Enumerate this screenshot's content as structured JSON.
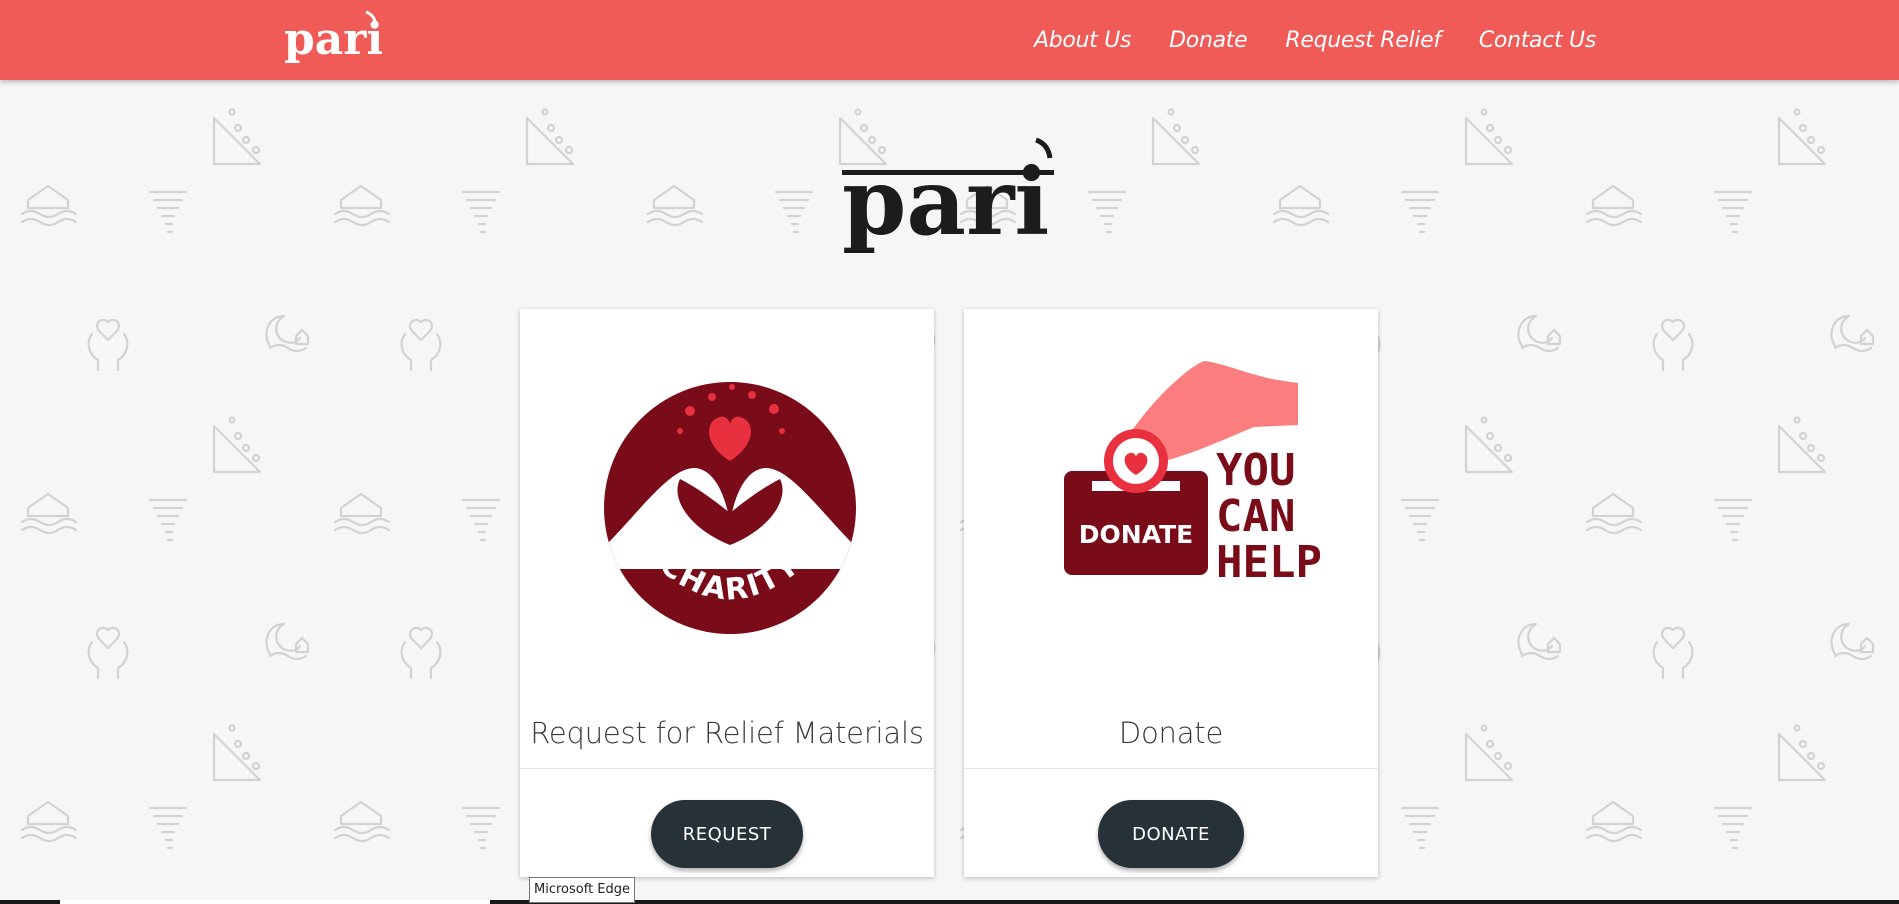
{
  "brand": {
    "logo_text": "pari"
  },
  "nav": {
    "links": [
      {
        "label": "About Us"
      },
      {
        "label": "Donate"
      },
      {
        "label": "Request Relief"
      },
      {
        "label": "Contact Us"
      }
    ]
  },
  "hero": {
    "logo_text": "pari"
  },
  "cards": [
    {
      "image_text": "CHARITY",
      "title": "Request for Relief Materials",
      "button_label": "REQUEST"
    },
    {
      "image_text_donate": "DONATE",
      "image_text_you": "YOU",
      "image_text_can": "CAN",
      "image_text_help": "HELP",
      "title": "Donate",
      "button_label": "DONATE"
    }
  ],
  "tooltip": {
    "text": "Microsoft Edge"
  },
  "colors": {
    "navbar": "#f05a57",
    "button": "#263238",
    "charity_maroon": "#7a0b18",
    "heart_red": "#e8303f",
    "hand_pink": "#fb7d7d",
    "pattern_icon": "#d2d2d2"
  }
}
